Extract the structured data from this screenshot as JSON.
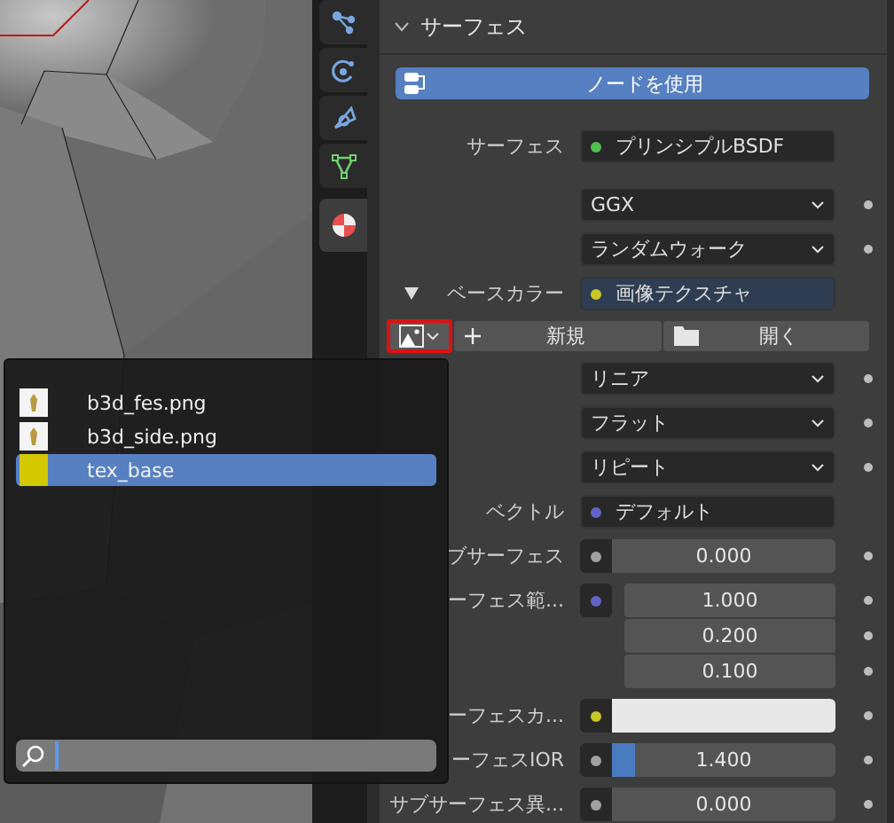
{
  "tabs": [
    {
      "kind": "particles",
      "selected": false
    },
    {
      "kind": "physics",
      "selected": false
    },
    {
      "kind": "constraints",
      "selected": false
    },
    {
      "kind": "data",
      "selected": false
    },
    {
      "kind": "material",
      "selected": true
    }
  ],
  "panel": {
    "title": "サーフェス",
    "expanded": true
  },
  "use_nodes_button": {
    "label": "ノードを使用"
  },
  "rows": [
    {
      "kind": "socket",
      "label": "サーフェス",
      "value": "プリンシプルBSDF",
      "color": "#4fc14f",
      "linked": false
    },
    {
      "kind": "dropdown",
      "value": "GGX"
    },
    {
      "kind": "dropdown",
      "value": "ランダムウォーク"
    },
    {
      "kind": "socket",
      "label": "ベースカラー",
      "value": "画像テクスチャ",
      "color": "#c7c729",
      "linked": true
    },
    {
      "kind": "image_buttons",
      "new_label": "新規",
      "open_label": "開く"
    },
    {
      "kind": "dropdown",
      "value": "リニア"
    },
    {
      "kind": "dropdown",
      "value": "フラット"
    },
    {
      "kind": "dropdown",
      "value": "リピート"
    },
    {
      "kind": "socket",
      "label": "ベクトル",
      "value": "デフォルト",
      "color": "#6363c7",
      "linked": false
    },
    {
      "kind": "number",
      "label": "ブサーフェス",
      "value": "0.000",
      "color": "#a1a1a1"
    },
    {
      "kind": "vector",
      "label": "ーフェス範...",
      "values": [
        "1.000",
        "0.200",
        "0.100"
      ],
      "color": "#6363c7"
    },
    {
      "kind": "color",
      "label": "ーフェスカ...",
      "color": "#c7c729"
    },
    {
      "kind": "slider",
      "label": "ーフェスIOR",
      "value": "1.400",
      "level": 0.1,
      "color": "#a1a1a1"
    },
    {
      "kind": "number",
      "label": "サブサーフェス異...",
      "value": "0.000",
      "color": "#a1a1a1"
    }
  ],
  "image_popup": {
    "items": [
      {
        "kind": "thumbnail",
        "name": "b3d_fes.png",
        "selected": false
      },
      {
        "kind": "thumbnail",
        "name": "b3d_side.png",
        "selected": false
      },
      {
        "kind": "swatch",
        "name": "tex_base",
        "selected": true,
        "color": "#d4c800"
      }
    ]
  }
}
